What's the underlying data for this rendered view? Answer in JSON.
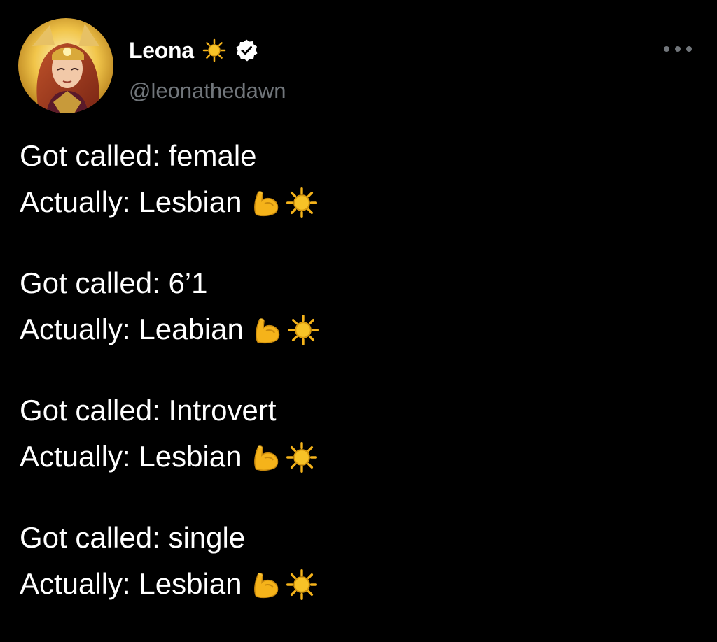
{
  "author": {
    "display_name": "Leona",
    "handle": "@leonathedawn",
    "name_emoji": "sun-icon",
    "verified": true,
    "verified_badge": "verified-badge-icon",
    "avatar_icon": "avatar-image"
  },
  "menu": {
    "icon": "more-options-icon"
  },
  "tweet": {
    "stanzas": [
      {
        "called": "Got called: female",
        "actually": "Actually: Lesbian"
      },
      {
        "called": "Got called: 6’1",
        "actually": "Actually: Leabian"
      },
      {
        "called": "Got called: Introvert",
        "actually": "Actually: Lesbian"
      },
      {
        "called": "Got called: single",
        "actually": "Actually: Lesbian"
      }
    ],
    "line_emojis": [
      "flexed-biceps-icon",
      "sun-icon"
    ]
  },
  "colors": {
    "background": "#000000",
    "text": "#ffffff",
    "secondary_text": "#71767b",
    "emoji_gold": "#f5b31a"
  }
}
